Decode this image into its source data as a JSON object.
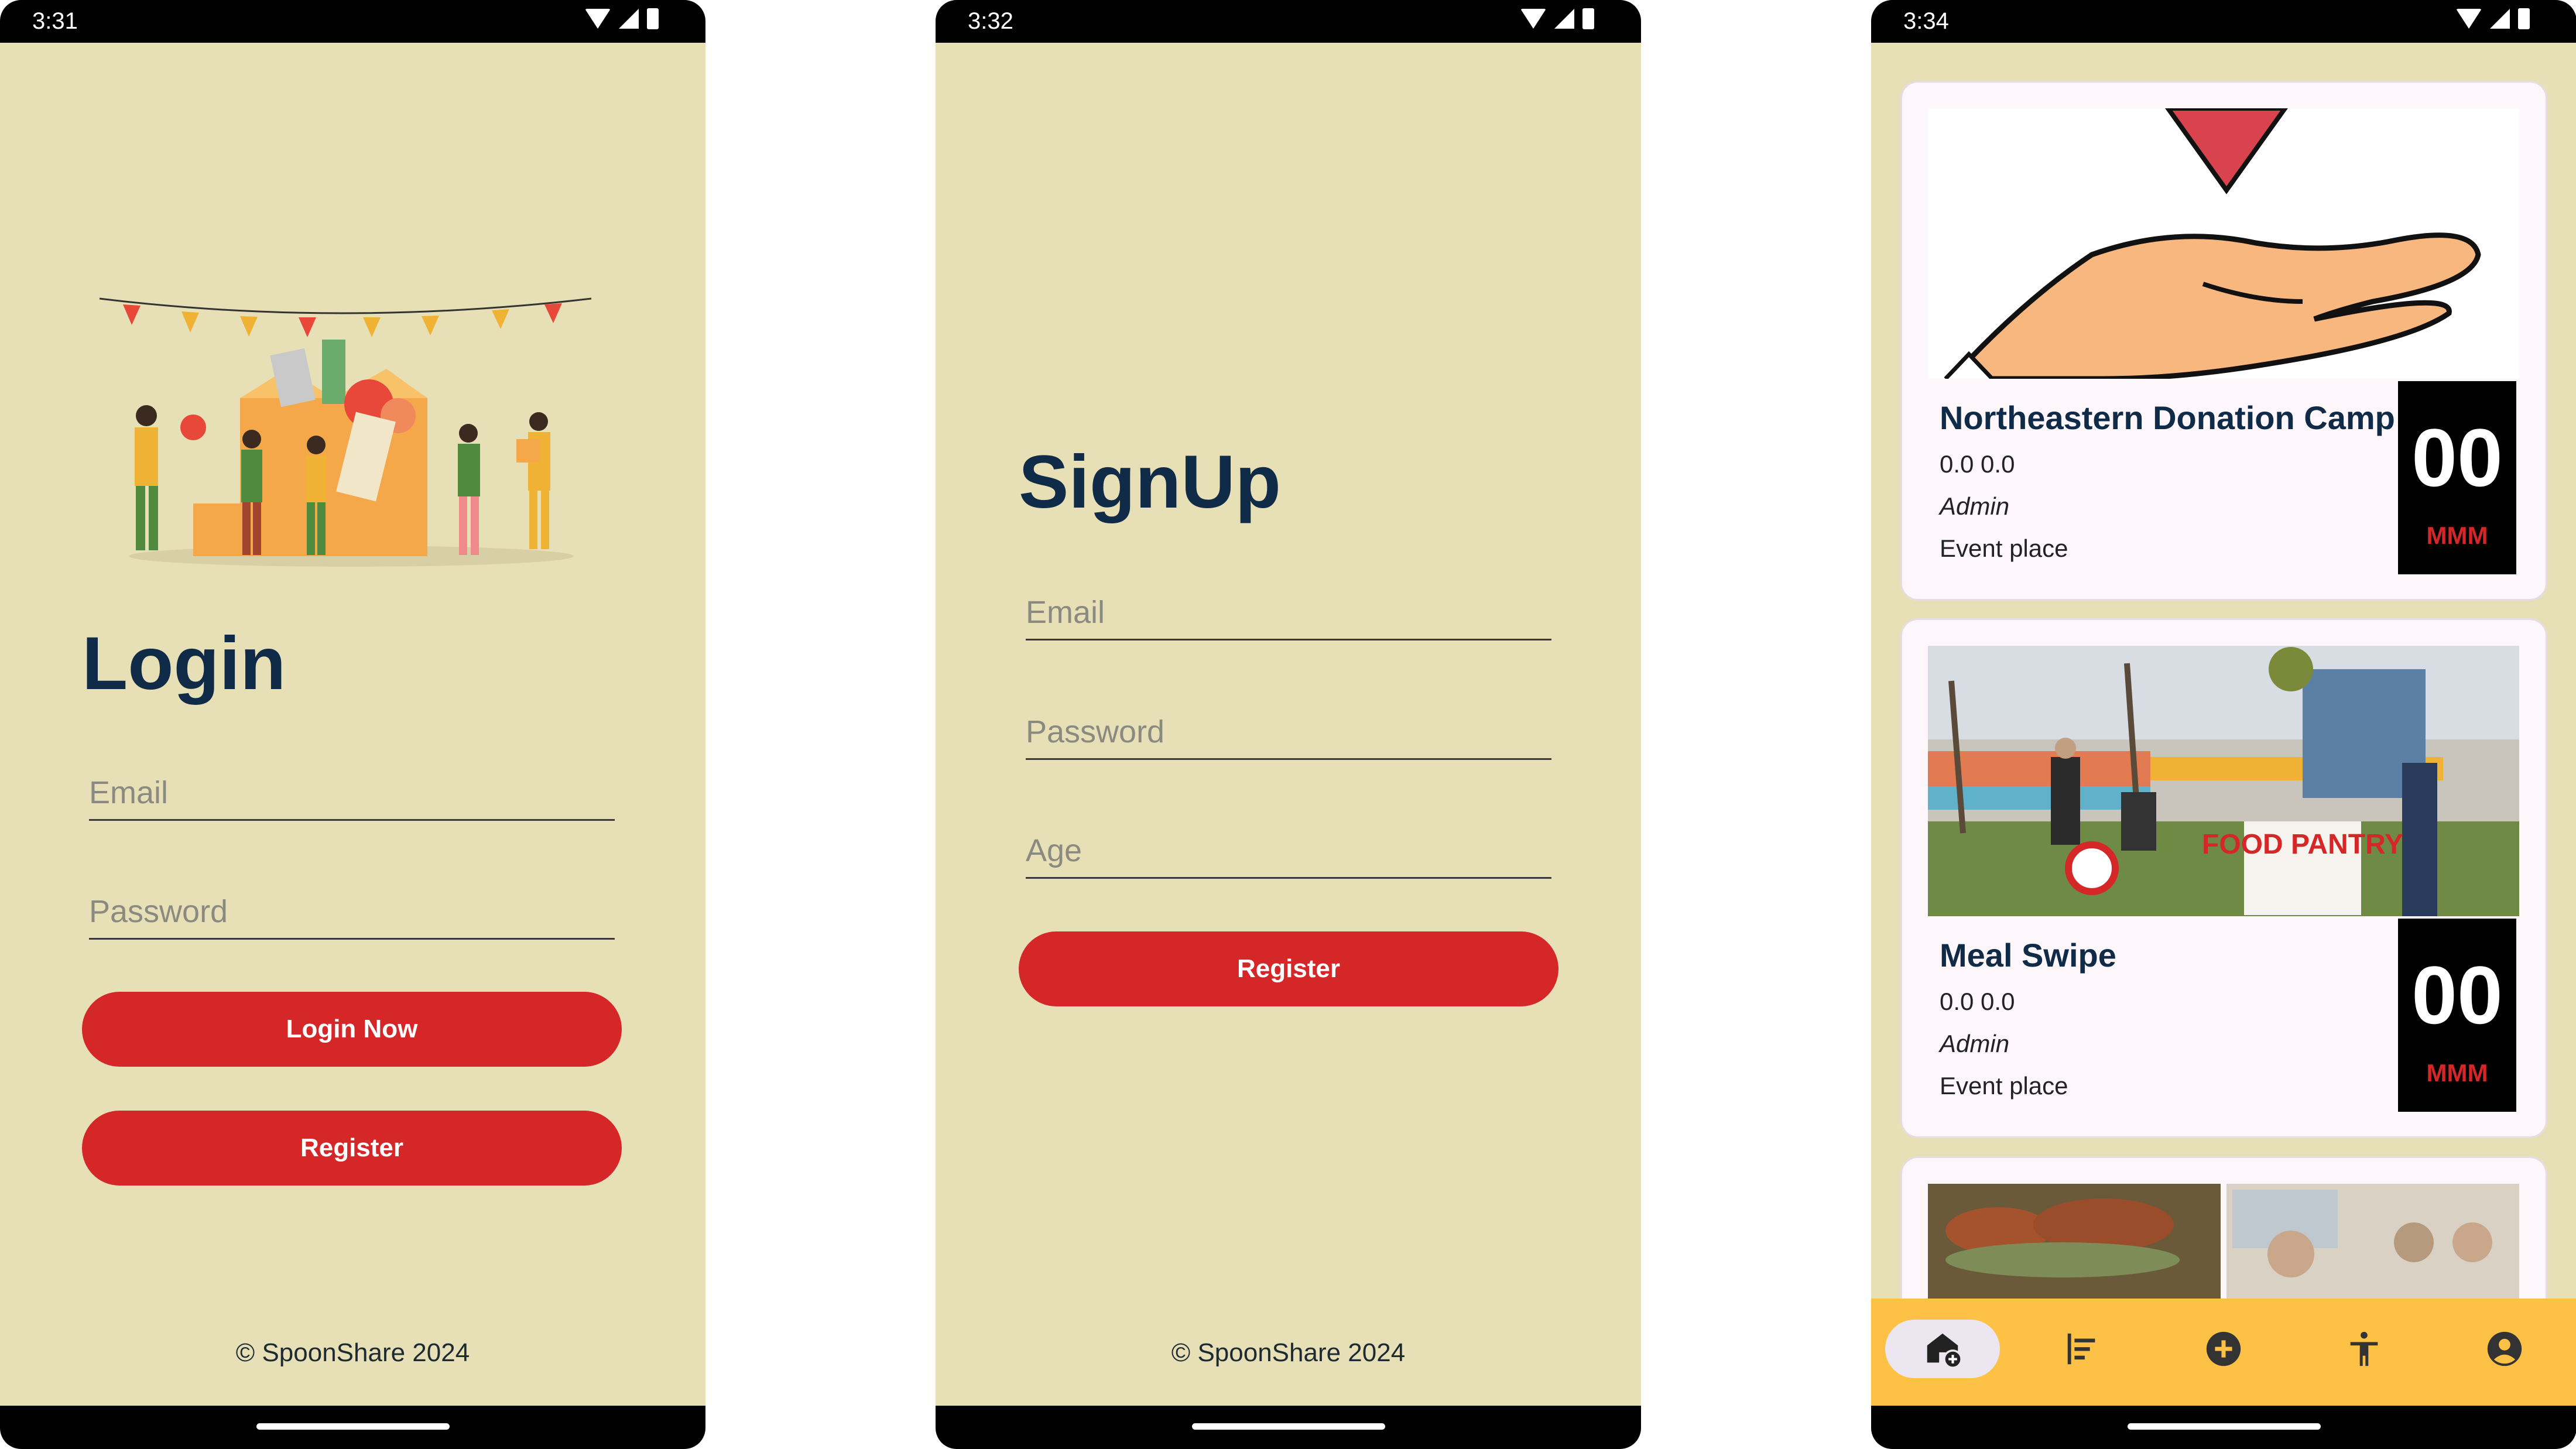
{
  "screens": {
    "login": {
      "status_time": "3:31",
      "title": "Login",
      "email_placeholder": "Email",
      "password_placeholder": "Password",
      "login_button": "Login Now",
      "register_button": "Register",
      "footer": "© SpoonShare 2024"
    },
    "signup": {
      "status_time": "3:32",
      "title": "SignUp",
      "email_placeholder": "Email",
      "password_placeholder": "Password",
      "age_placeholder": "Age",
      "register_button": "Register",
      "footer": "© SpoonShare 2024"
    },
    "events": {
      "status_time": "3:34",
      "cards": [
        {
          "title": "Northeastern Donation Camp",
          "coords": "0.0 0.0",
          "author": "Admin",
          "place": "Event place",
          "day": "00",
          "month": "MMM"
        },
        {
          "title": "Meal Swipe",
          "coords": "0.0 0.0",
          "author": "Admin",
          "place": "Event place",
          "day": "00",
          "month": "MMM",
          "sign_text": "FOOD PANTRY"
        }
      ],
      "bottom_nav": [
        {
          "icon": "home-add-icon",
          "active": true
        },
        {
          "icon": "sort-list-icon",
          "active": false
        },
        {
          "icon": "add-circle-icon",
          "active": false
        },
        {
          "icon": "accessibility-icon",
          "active": false
        },
        {
          "icon": "account-circle-icon",
          "active": false
        }
      ]
    }
  },
  "colors": {
    "background": "#e7e0b6",
    "primary_button": "#d52628",
    "title_text": "#0f2b47",
    "bottom_nav": "#fcc145"
  }
}
